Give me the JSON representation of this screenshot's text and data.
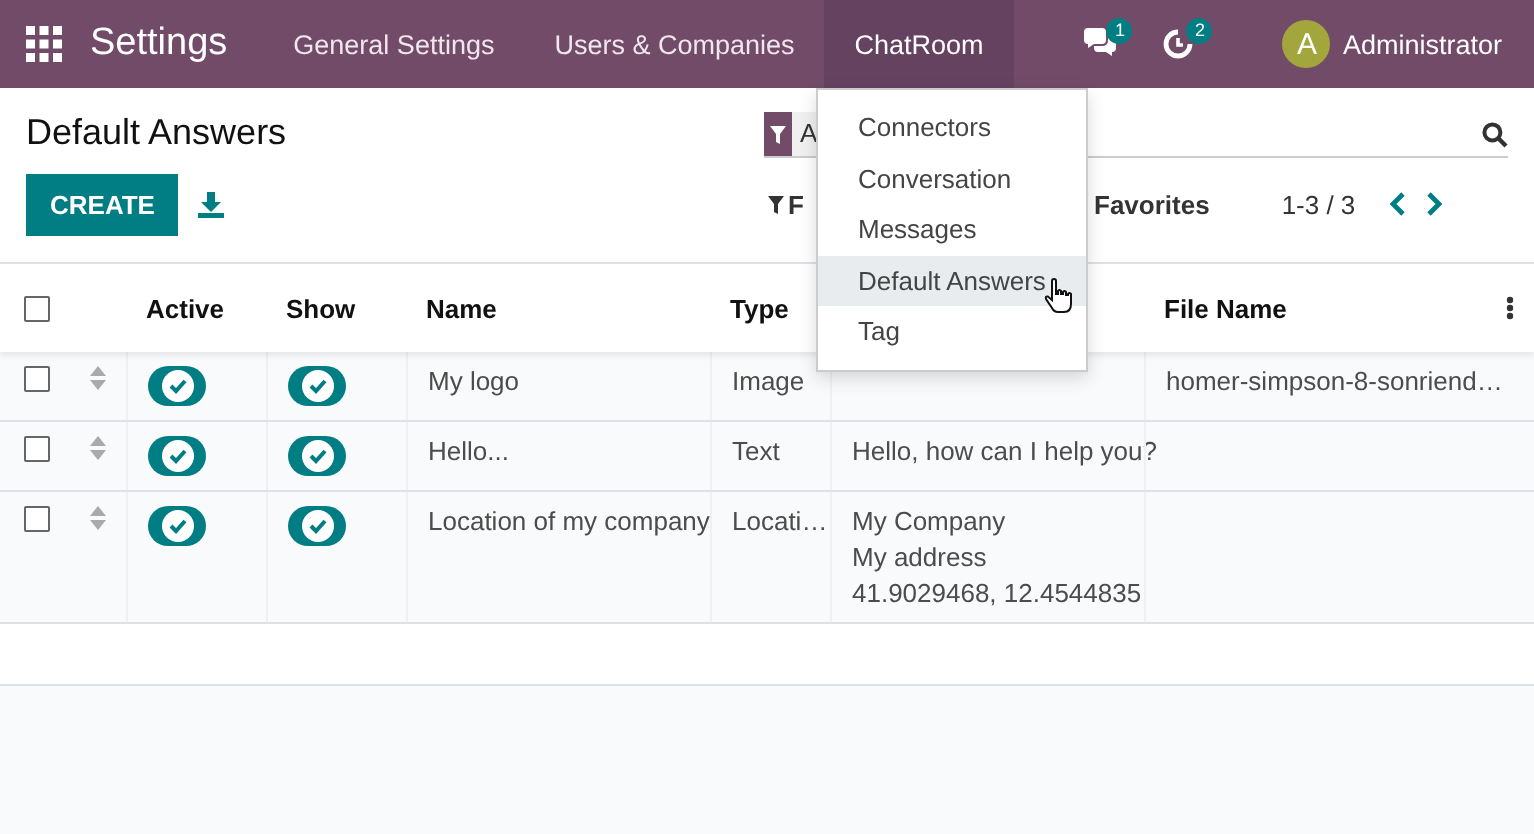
{
  "navbar": {
    "app_title": "Settings",
    "menus": [
      {
        "label": "General Settings",
        "selected": false
      },
      {
        "label": "Users & Companies",
        "selected": false
      },
      {
        "label": "ChatRoom",
        "selected": true
      }
    ],
    "messages_badge": "1",
    "activities_badge": "2",
    "user": {
      "initial": "A",
      "name": "Administrator"
    }
  },
  "dropdown": {
    "items": [
      {
        "label": "Connectors",
        "selected": false
      },
      {
        "label": "Conversation",
        "selected": false
      },
      {
        "label": "Messages",
        "selected": false
      },
      {
        "label": "Default Answers",
        "selected": true
      },
      {
        "label": "Tag",
        "selected": false
      }
    ]
  },
  "control_panel": {
    "title": "Default Answers",
    "create_label": "CREATE",
    "search_facet": "A",
    "filters_label": "F",
    "favorites_label": "Favorites",
    "pager": "1-3 / 3"
  },
  "table": {
    "header_checked": false,
    "columns": [
      "Active",
      "Show",
      "Name",
      "Type",
      "File Name"
    ],
    "rows": [
      {
        "selected": false,
        "active": true,
        "show": true,
        "name": "My logo",
        "type": "Image",
        "content": [],
        "file_name": "homer-simpson-8-sonriend…"
      },
      {
        "selected": false,
        "active": true,
        "show": true,
        "name": "Hello...",
        "type": "Text",
        "content": [
          "Hello, how can I help you?"
        ],
        "file_name": ""
      },
      {
        "selected": false,
        "active": true,
        "show": true,
        "name": "Location of my company",
        "type": "Locati…",
        "content": [
          "My Company",
          "My address",
          "41.9029468, 12.4544835"
        ],
        "file_name": ""
      }
    ]
  }
}
